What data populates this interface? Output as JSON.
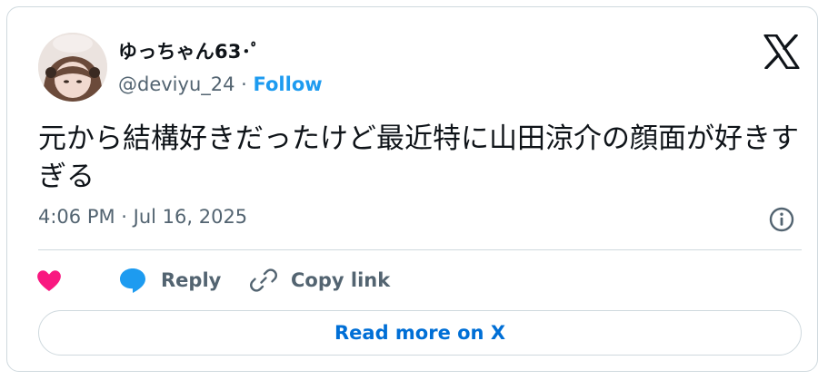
{
  "author": {
    "display_name": "ゆっちゃん63･ﾟ",
    "handle": "@deviyu_24",
    "separator": " · ",
    "follow_label": "Follow"
  },
  "tweet": {
    "text": "元から結構好きだったけど最近特に山田涼介の顔面が好きすぎる",
    "timestamp": "4:06 PM · Jul 16, 2025"
  },
  "actions": {
    "like_icon": "heart-icon",
    "reply_label": "Reply",
    "copy_link_label": "Copy link"
  },
  "read_more_label": "Read more on X",
  "icons": [
    "x-logo-icon",
    "info-icon",
    "heart-icon",
    "reply-bubble-icon",
    "link-icon"
  ],
  "colors": {
    "follow": "#1d9bf0",
    "heart": "#f91880",
    "reply_bubble": "#1d9bf0",
    "read_more": "#006fd6",
    "muted_text": "#536471",
    "border": "#cfd9de"
  }
}
